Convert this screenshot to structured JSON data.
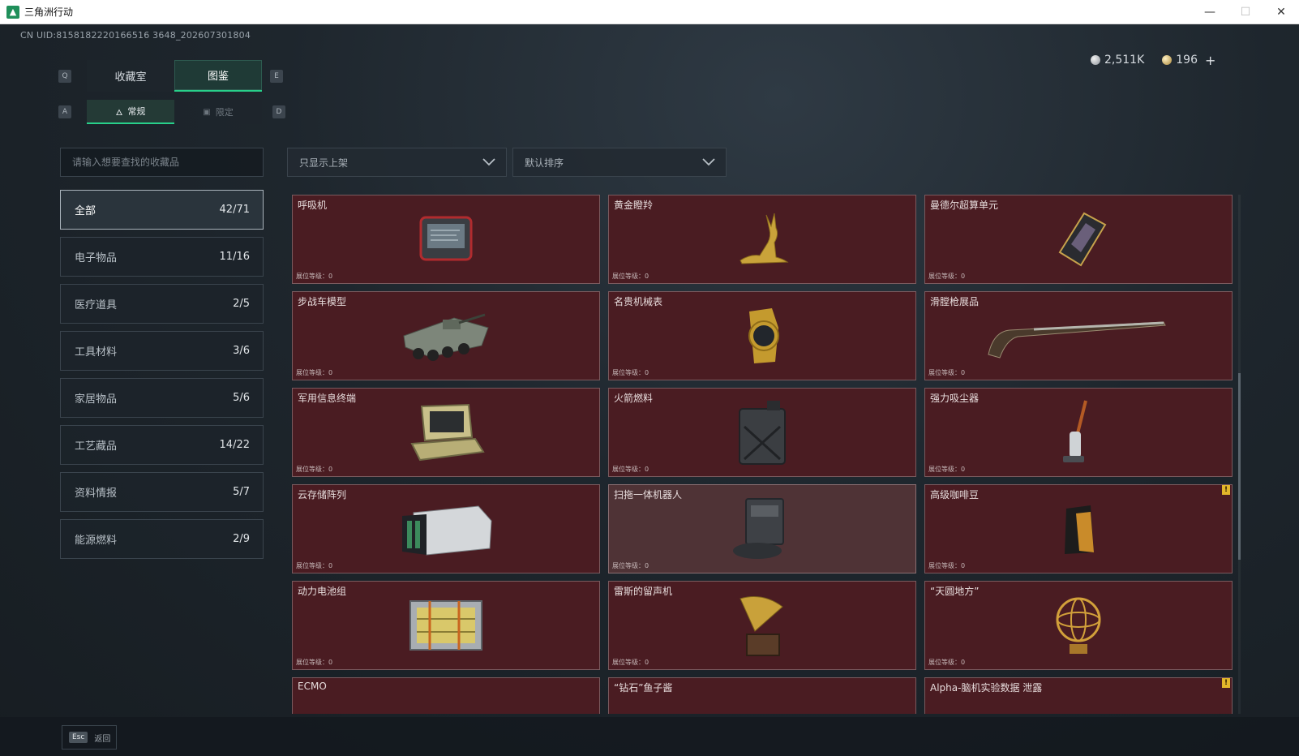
{
  "window": {
    "title": "三角洲行动",
    "controls": {
      "minimize": "—",
      "maximize": "☐",
      "close": "✕"
    }
  },
  "uid": "CN UID:8158182220166516 3648_202607301804",
  "currency": {
    "silver": "2,511K",
    "gold": "196",
    "add": "+"
  },
  "keys": {
    "q": "Q",
    "e": "E",
    "a": "A",
    "d": "D"
  },
  "main_tabs": [
    {
      "label": "收藏室",
      "active": false
    },
    {
      "label": "图鉴",
      "active": true
    }
  ],
  "sub_tabs": [
    {
      "label": "常规",
      "icon": "flame-icon",
      "active": true
    },
    {
      "label": "限定",
      "icon": "image-icon",
      "active": false
    }
  ],
  "search": {
    "placeholder": "请输入想要查找的收藏品"
  },
  "filters": {
    "shelf_filter": "只显示上架",
    "sort": "默认排序"
  },
  "categories": [
    {
      "label": "全部",
      "count": "42/71",
      "active": true
    },
    {
      "label": "电子物品",
      "count": "11/16"
    },
    {
      "label": "医疗道具",
      "count": "2/5"
    },
    {
      "label": "工具材料",
      "count": "3/6"
    },
    {
      "label": "家居物品",
      "count": "5/6"
    },
    {
      "label": "工艺藏品",
      "count": "14/22"
    },
    {
      "label": "资料情报",
      "count": "5/7"
    },
    {
      "label": "能源燃料",
      "count": "2/9"
    }
  ],
  "level_label": "展位等级：0",
  "items": [
    {
      "name": "呼吸机",
      "icon": "ventilator-icon"
    },
    {
      "name": "黄金瞪羚",
      "icon": "golden-gazelle-icon"
    },
    {
      "name": "曼德尔超算单元",
      "icon": "computing-unit-icon"
    },
    {
      "name": "步战车模型",
      "icon": "ifv-model-icon"
    },
    {
      "name": "名贵机械表",
      "icon": "mechanical-watch-icon"
    },
    {
      "name": "滑膛枪展品",
      "icon": "musket-icon"
    },
    {
      "name": "军用信息终端",
      "icon": "military-terminal-icon"
    },
    {
      "name": "火箭燃料",
      "icon": "fuel-jerrycan-icon"
    },
    {
      "name": "强力吸尘器",
      "icon": "vacuum-cleaner-icon"
    },
    {
      "name": "云存储阵列",
      "icon": "storage-array-icon"
    },
    {
      "name": "扫拖一体机器人",
      "icon": "robot-vacuum-icon",
      "highlight": true
    },
    {
      "name": "高级咖啡豆",
      "icon": "coffee-bag-icon",
      "warning": true
    },
    {
      "name": "动力电池组",
      "icon": "battery-pack-icon"
    },
    {
      "name": "雷斯的留声机",
      "icon": "gramophone-icon"
    },
    {
      "name": "“天圆地方”",
      "icon": "armillary-sphere-icon"
    },
    {
      "name": "ECMO",
      "icon": "ecmo-icon"
    },
    {
      "name": "“钻石”鱼子酱",
      "icon": "caviar-icon"
    },
    {
      "name": "Alpha-脑机实验数据 泄露",
      "icon": "data-drive-icon",
      "warning": true
    }
  ],
  "footer": {
    "esc_key": "Esc",
    "back_label": "返回"
  }
}
